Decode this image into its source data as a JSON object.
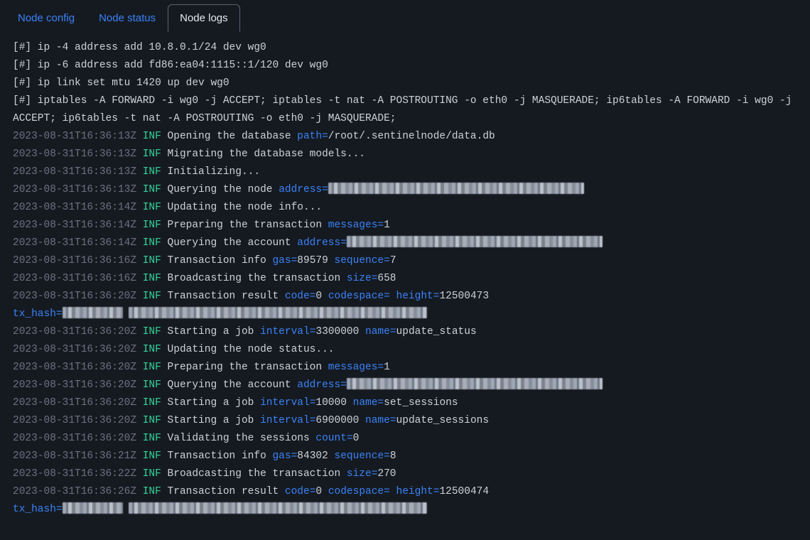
{
  "tabs": [
    {
      "label": "Node config",
      "active": false
    },
    {
      "label": "Node status",
      "active": false
    },
    {
      "label": "Node logs",
      "active": true
    }
  ],
  "logs": {
    "pre": [
      "[#] ip -4 address add 10.8.0.1/24 dev wg0",
      "[#] ip -6 address add fd86:ea04:1115::1/120 dev wg0",
      "[#] ip link set mtu 1420 up dev wg0",
      "[#] iptables -A FORWARD -i wg0 -j ACCEPT; iptables -t nat -A POSTROUTING -o eth0 -j MASQUERADE; ip6tables -A FORWARD -i wg0 -j ACCEPT; ip6tables -t nat -A POSTROUTING -o eth0 -j MASQUERADE;"
    ],
    "lines": [
      {
        "ts": "2023-08-31T16:36:13Z",
        "lvl": "INF",
        "msg": "Opening the database",
        "kv": [
          [
            "path=",
            "/root/.sentinelnode/data.db"
          ]
        ]
      },
      {
        "ts": "2023-08-31T16:36:13Z",
        "lvl": "INF",
        "msg": "Migrating the database models...",
        "kv": []
      },
      {
        "ts": "2023-08-31T16:36:13Z",
        "lvl": "INF",
        "msg": "Initializing...",
        "kv": []
      },
      {
        "ts": "2023-08-31T16:36:13Z",
        "lvl": "INF",
        "msg": "Querying the node",
        "kv": [
          [
            "address=",
            "@cen:w360"
          ]
        ]
      },
      {
        "ts": "2023-08-31T16:36:14Z",
        "lvl": "INF",
        "msg": "Updating the node info...",
        "kv": []
      },
      {
        "ts": "2023-08-31T16:36:14Z",
        "lvl": "INF",
        "msg": "Preparing the transaction",
        "kv": [
          [
            "messages=",
            "1"
          ]
        ]
      },
      {
        "ts": "2023-08-31T16:36:14Z",
        "lvl": "INF",
        "msg": "Querying the account",
        "kv": [
          [
            "address=",
            "@cen:w360"
          ]
        ]
      },
      {
        "ts": "2023-08-31T16:36:16Z",
        "lvl": "INF",
        "msg": "Transaction info",
        "kv": [
          [
            "gas=",
            "89579"
          ],
          [
            "sequence=",
            "7"
          ]
        ]
      },
      {
        "ts": "2023-08-31T16:36:16Z",
        "lvl": "INF",
        "msg": "Broadcasting the transaction",
        "kv": [
          [
            "size=",
            "658"
          ]
        ]
      },
      {
        "ts": "2023-08-31T16:36:20Z",
        "lvl": "INF",
        "msg": "Transaction result",
        "kv": [
          [
            "code=",
            "0"
          ],
          [
            "codespace=",
            ""
          ],
          [
            "height=",
            "12500473"
          ]
        ],
        "trail": {
          "key": "tx_hash=",
          "cen1": "w85",
          "cen2": "w420"
        }
      },
      {
        "ts": "2023-08-31T16:36:20Z",
        "lvl": "INF",
        "msg": "Starting a job",
        "kv": [
          [
            "interval=",
            "3300000"
          ],
          [
            "name=",
            "update_status"
          ]
        ]
      },
      {
        "ts": "2023-08-31T16:36:20Z",
        "lvl": "INF",
        "msg": "Updating the node status...",
        "kv": []
      },
      {
        "ts": "2023-08-31T16:36:20Z",
        "lvl": "INF",
        "msg": "Preparing the transaction",
        "kv": [
          [
            "messages=",
            "1"
          ]
        ]
      },
      {
        "ts": "2023-08-31T16:36:20Z",
        "lvl": "INF",
        "msg": "Querying the account",
        "kv": [
          [
            "address=",
            "@cen:w360"
          ]
        ]
      },
      {
        "ts": "2023-08-31T16:36:20Z",
        "lvl": "INF",
        "msg": "Starting a job",
        "kv": [
          [
            "interval=",
            "10000"
          ],
          [
            "name=",
            "set_sessions"
          ]
        ]
      },
      {
        "ts": "2023-08-31T16:36:20Z",
        "lvl": "INF",
        "msg": "Starting a job",
        "kv": [
          [
            "interval=",
            "6900000"
          ],
          [
            "name=",
            "update_sessions"
          ]
        ]
      },
      {
        "ts": "2023-08-31T16:36:20Z",
        "lvl": "INF",
        "msg": "Validating the sessions",
        "kv": [
          [
            "count=",
            "0"
          ]
        ]
      },
      {
        "ts": "2023-08-31T16:36:21Z",
        "lvl": "INF",
        "msg": "Transaction info",
        "kv": [
          [
            "gas=",
            "84302"
          ],
          [
            "sequence=",
            "8"
          ]
        ]
      },
      {
        "ts": "2023-08-31T16:36:22Z",
        "lvl": "INF",
        "msg": "Broadcasting the transaction",
        "kv": [
          [
            "size=",
            "270"
          ]
        ]
      },
      {
        "ts": "2023-08-31T16:36:26Z",
        "lvl": "INF",
        "msg": "Transaction result",
        "kv": [
          [
            "code=",
            "0"
          ],
          [
            "codespace=",
            ""
          ],
          [
            "height=",
            "12500474"
          ]
        ],
        "trail": {
          "key": "tx_hash=",
          "cen1": "w85",
          "cen2": "w420"
        }
      }
    ]
  }
}
